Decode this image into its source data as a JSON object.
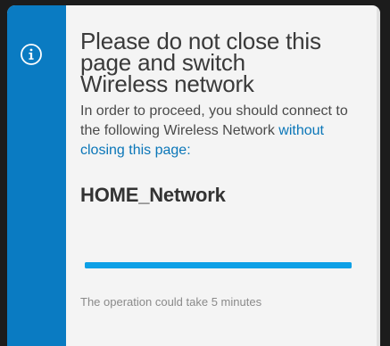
{
  "dialog": {
    "icon": "info-icon",
    "title_line1": "Please do not close this",
    "title_line2": "page and switch",
    "title_line3": "Wireless network",
    "body_part1": "In order to proceed, you should connect to the following Wireless Network ",
    "body_link": "without closing this page:",
    "network_name": "HOME_Network",
    "progress": 1.0,
    "footnote": "The operation could take 5 minutes"
  },
  "colors": {
    "accent": "#0a7bc2",
    "progress": "#0ea0e6",
    "link": "#0a76b8",
    "background": "#f4f4f4"
  }
}
